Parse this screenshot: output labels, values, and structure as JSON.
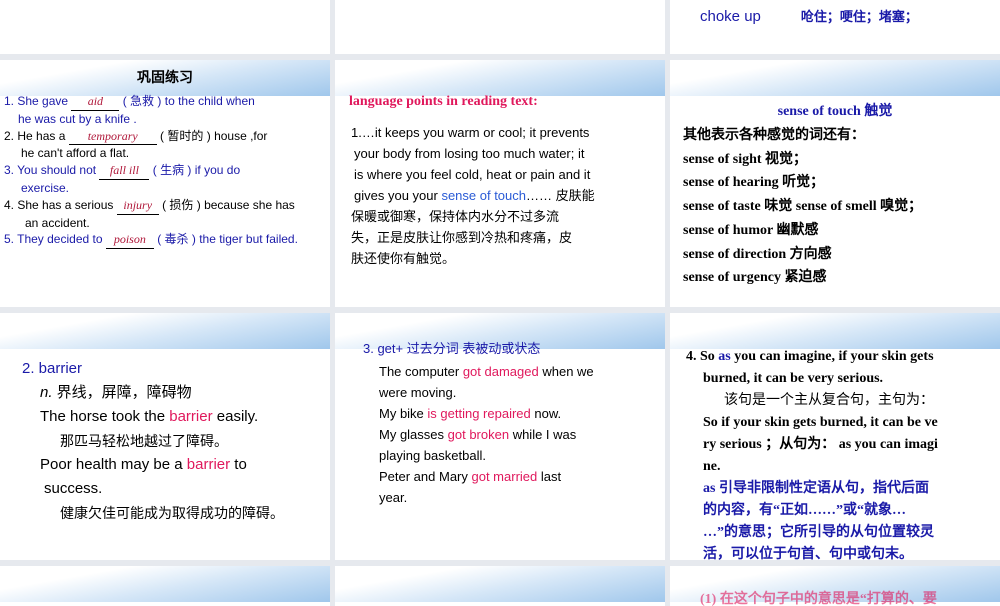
{
  "slide_top_right": {
    "term": "choke up",
    "meaning": "呛住；哽住；堵塞；"
  },
  "slide_exercise": {
    "title": "巩固练习",
    "items": [
      {
        "pre": "1. She gave ",
        "ans": "aid",
        "cn": " ( 急救 ) ",
        "post": "to the child when",
        "cont": "he was cut by a knife ."
      },
      {
        "pre": "2. He has a ",
        "ans": "temporary",
        "cn": " ( 暂时的 ) ",
        "post": "house ,for",
        "cont": "he can't afford a flat."
      },
      {
        "pre": "3. You should not ",
        "ans": "fall ill",
        "cn": " ( 生病 ) ",
        "post": "if you do",
        "cont": "exercise."
      },
      {
        "pre": "4. She has a serious ",
        "ans": "injury",
        "cn": " ( 损伤 ) ",
        "post": "because she has",
        "cont": "an accident."
      },
      {
        "pre": "5. They decided to ",
        "ans": "poison",
        "cn": " ( 毒杀 ) ",
        "post": "the tiger but failed.",
        "cont": ""
      }
    ]
  },
  "slide_lang": {
    "heading": "language points in reading text:",
    "line1": "1.…it keeps you warm or cool; it prevents",
    "line2": "your body from losing too much water; it",
    "line3": "is where you feel cold, heat or pain and it",
    "line4a": "gives you your ",
    "line4b": "sense of touch",
    "line4c": "…… 皮肤能",
    "line5": "保暖或御寒，保持体内水分不过多流",
    "line6": "失，正是皮肤让你感到冷热和疼痛，皮",
    "line7": "肤还使你有触觉。"
  },
  "slide_senses": {
    "title": "sense of touch 触觉",
    "intro": "其他表示各种感觉的词还有：",
    "items": [
      "sense of sight 视觉；",
      "sense of hearing 听觉；",
      "sense of taste 味觉    sense of smell 嗅觉；",
      "sense of humor  幽默感",
      "sense of direction  方向感",
      "sense of urgency 紧迫感"
    ]
  },
  "slide_barrier": {
    "title": "2. barrier",
    "pos": "n.",
    "def": " 界线，屏障，障碍物",
    "ex1a": "The horse took the ",
    "ex1b": "barrier",
    "ex1c": " easily.",
    "ex1cn": "那匹马轻松地越过了障碍。",
    "ex2a": "Poor health may be a ",
    "ex2b": "barrier",
    "ex2c": " to",
    "ex2d": "success.",
    "ex2cn": "健康欠佳可能成为取得成功的障碍。"
  },
  "slide_get": {
    "title": "3. get+ 过去分词    表被动或状态",
    "lines": [
      {
        "a": "The computer ",
        "b": "got damaged",
        "c": " when we"
      },
      {
        "a": "were moving.",
        "b": "",
        "c": ""
      },
      {
        "a": "My bike ",
        "b": "is getting repaired",
        "c": " now."
      },
      {
        "a": "My glasses ",
        "b": "got broken",
        "c": " while I was"
      },
      {
        "a": "playing basketball.",
        "b": "",
        "c": ""
      },
      {
        "a": "Peter and Mary ",
        "b": "got married",
        "c": " last"
      },
      {
        "a": "year.",
        "b": "",
        "c": ""
      }
    ]
  },
  "slide_as": {
    "l1a": "4. So ",
    "l1b": "as",
    "l1c": " you can imagine, if your skin gets",
    "l2": "burned, it can be very serious.",
    "l3": "该句是一个主从复合句，主句为：",
    "l4": "So if your skin gets burned, it can be ve",
    "l5": "ry serious ；从句为： as you can imagi",
    "l6": "ne.",
    "b1": "as 引导非限制性定语从句，指代后面",
    "b2": "的内容，有“正如……”或“就象…",
    "b3": "…”的意思；它所引导的从句位置较灵",
    "b4": "活，可以位于句首、句中或句末。"
  },
  "slide_bottom_right": {
    "partial": "(1) 在这个句子中的意思是“打算的、要"
  }
}
